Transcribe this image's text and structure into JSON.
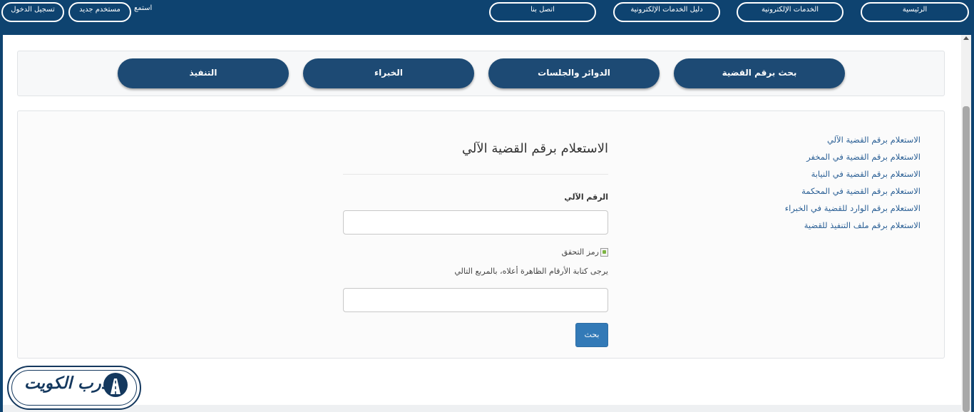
{
  "topbar": {
    "nav": [
      {
        "label": "الرئيسية"
      },
      {
        "label": "الخدمات الإلكترونية"
      },
      {
        "label": "دليل الخدمات الإلكترونية"
      },
      {
        "label": "اتصل بنا"
      }
    ],
    "listen": "استمع",
    "new_user": "مستخدم جديد",
    "login": "تسجيل الدخول"
  },
  "tabs": [
    {
      "label": "بحث برقم القضية"
    },
    {
      "label": "الدوائر والجلسات"
    },
    {
      "label": "الخبراء"
    },
    {
      "label": "التنفيذ"
    }
  ],
  "sidebar": {
    "links": [
      {
        "label": "الاستعلام برقم القضية الآلي"
      },
      {
        "label": "الاستعلام برقم القضية في المخفر"
      },
      {
        "label": "الاستعلام برقم القضية في النيابة"
      },
      {
        "label": "الاستعلام برقم القضية في المحكمة"
      },
      {
        "label": "الاستعلام برقم الوارد للقضية في الخبراء"
      },
      {
        "label": "الاستعلام برقم ملف التنفيذ للقضية"
      }
    ]
  },
  "form": {
    "title": "الاستعلام برقم القضية الآلي",
    "number_label": "الرقم الآلي",
    "number_value": "",
    "captcha_alt": "رمز التحقق",
    "captcha_hint": "يرجى كتابة الأرقام الظاهرة أعلاه، بالمربع التالي",
    "captcha_value": "",
    "search_label": "بحث"
  },
  "logo": {
    "text": "درب الكويت"
  },
  "colors": {
    "primary": "#0e4370",
    "tab": "#1d4a74",
    "link": "#2a5f95",
    "button": "#337ab7"
  }
}
